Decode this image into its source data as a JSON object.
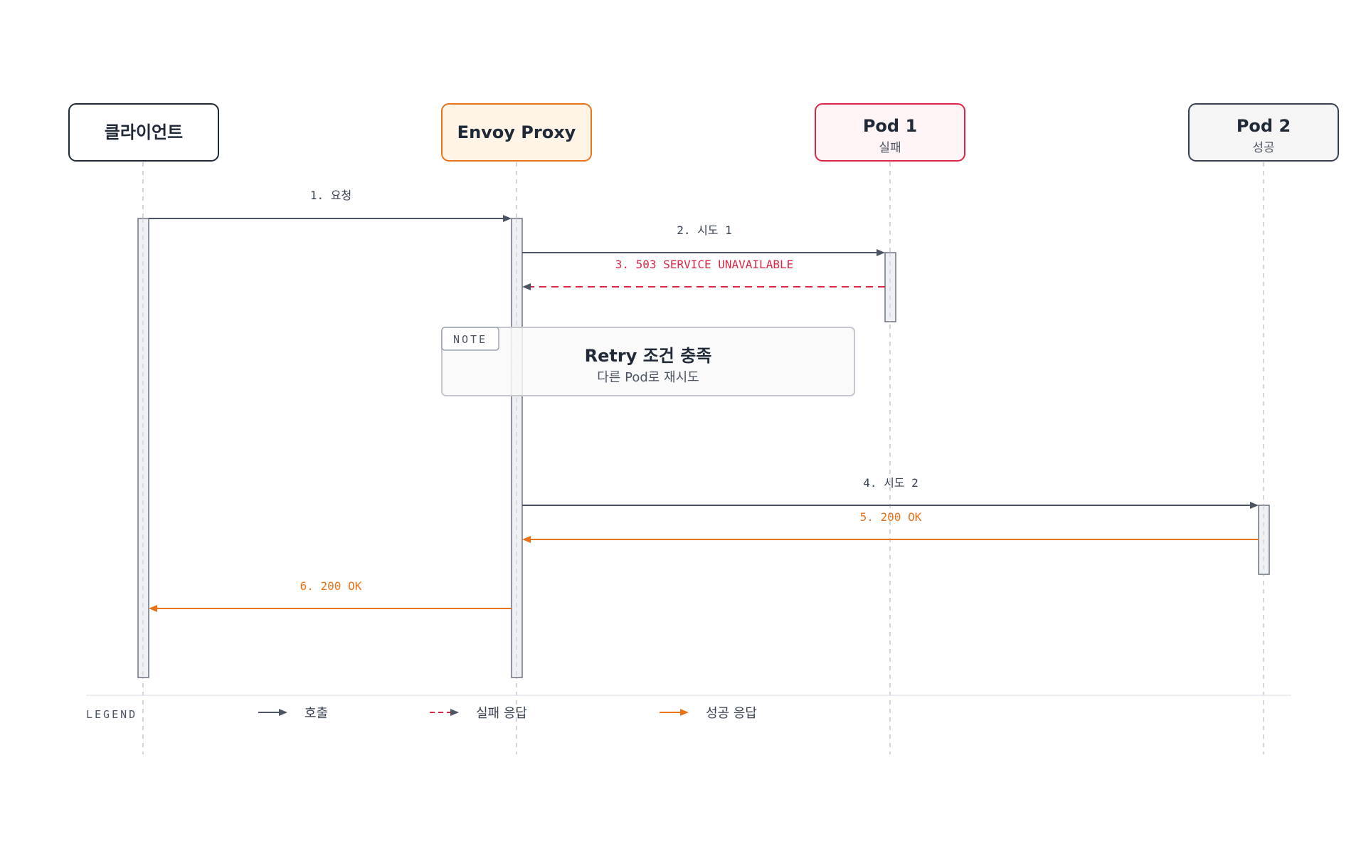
{
  "participants": [
    {
      "id": "client",
      "title": "클라이언트",
      "subtitle": "",
      "border": "#1f2937",
      "fill": "#ffffff"
    },
    {
      "id": "envoy",
      "title": "Envoy Proxy",
      "subtitle": "",
      "border": "#e8731a",
      "fill": "#fff4e6"
    },
    {
      "id": "pod1",
      "title": "Pod 1",
      "subtitle": "실패",
      "border": "#dc2645",
      "fill": "#fff5f6"
    },
    {
      "id": "pod2",
      "title": "Pod 2",
      "subtitle": "성공",
      "border": "#374151",
      "fill": "#f5f5f5"
    }
  ],
  "messages": [
    {
      "label": "1. 요청",
      "kind": "call"
    },
    {
      "label": "2. 시도 1",
      "kind": "call"
    },
    {
      "label": "3. 503 SERVICE UNAVAILABLE",
      "kind": "fail"
    },
    {
      "label": "4. 시도 2",
      "kind": "call"
    },
    {
      "label": "5. 200 OK",
      "kind": "success"
    },
    {
      "label": "6. 200 OK",
      "kind": "success"
    }
  ],
  "note": {
    "tag": "NOTE",
    "title": "Retry 조건 충족",
    "subtitle": "다른 Pod로 재시도"
  },
  "legend": {
    "title": "LEGEND",
    "items": [
      {
        "label": "호출",
        "kind": "call"
      },
      {
        "label": "실패 응답",
        "kind": "fail"
      },
      {
        "label": "성공 응답",
        "kind": "success"
      }
    ]
  },
  "colors": {
    "call": "#4b5563",
    "fail": "#dc2645",
    "success": "#e8731a",
    "lifeline": "#c4c8ce",
    "activation_fill": "#eef0f3",
    "activation_stroke": "#6b7280"
  }
}
